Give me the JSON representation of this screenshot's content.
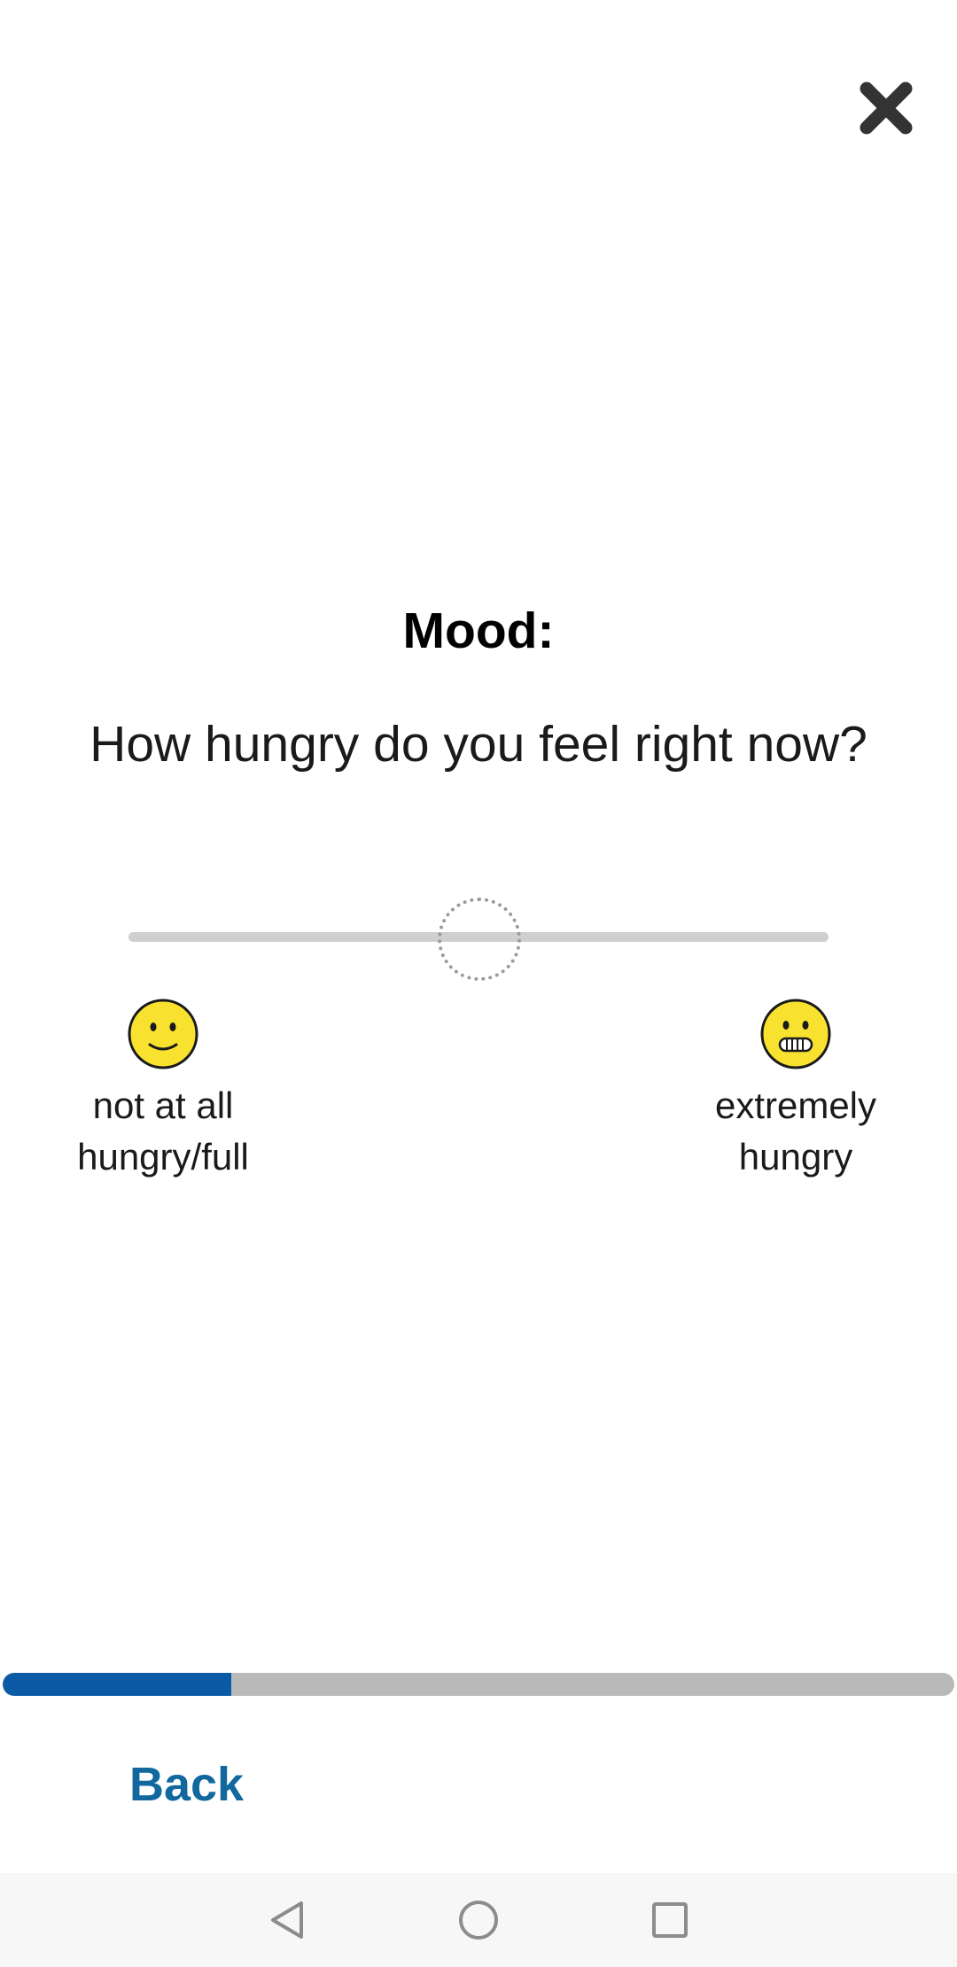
{
  "header": {
    "close_icon": "close-icon"
  },
  "question": {
    "category": "Mood:",
    "text": "How hungry do you feel right now?"
  },
  "slider": {
    "value": 0.5,
    "value_set": false,
    "min_anchor": {
      "label": "not at all\nhungry/full",
      "icon": "slightly-smiling-face-icon"
    },
    "max_anchor": {
      "label": "extremely\nhungry",
      "icon": "grimacing-face-icon"
    }
  },
  "progress": {
    "fraction": 0.24
  },
  "footer": {
    "back_label": "Back"
  },
  "system_nav": {
    "back_icon": "nav-back-icon",
    "home_icon": "nav-home-icon",
    "recents_icon": "nav-recents-icon"
  },
  "colors": {
    "accent": "#0b5aa5",
    "link": "#11689e",
    "emoji_yellow": "#f9e22f"
  }
}
